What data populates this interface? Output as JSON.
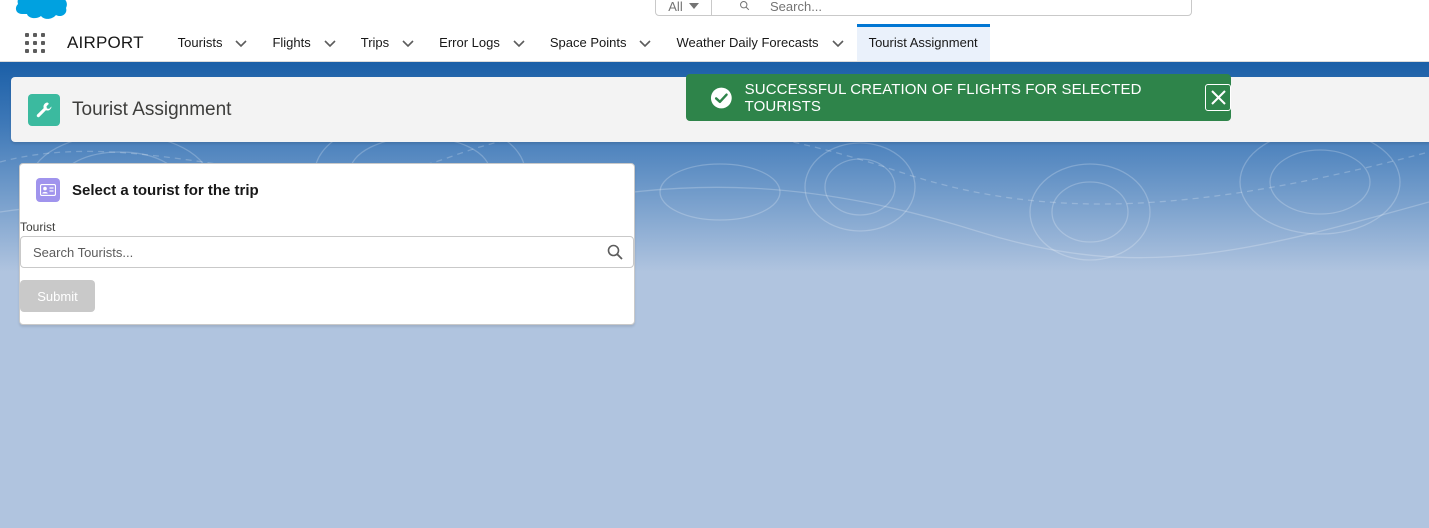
{
  "global_header": {
    "search": {
      "scope_label": "All",
      "placeholder": "Search..."
    }
  },
  "navbar": {
    "app_name": "AIRPORT",
    "items": [
      {
        "label": "Tourists",
        "has_menu": true
      },
      {
        "label": "Flights",
        "has_menu": true
      },
      {
        "label": "Trips",
        "has_menu": true
      },
      {
        "label": "Error Logs",
        "has_menu": true
      },
      {
        "label": "Space Points",
        "has_menu": true
      },
      {
        "label": "Weather Daily Forecasts",
        "has_menu": true
      },
      {
        "label": "Tourist Assignment",
        "has_menu": false,
        "active": true
      }
    ]
  },
  "page_header": {
    "title": "Tourist Assignment",
    "icon": "wrench-icon",
    "icon_color": "#3bba9f"
  },
  "toast": {
    "message": "SUCCESSFUL CREATION OF FLIGHTS FOR SELECTED TOURISTS",
    "variant": "success",
    "color": "#2e844a"
  },
  "card": {
    "title": "Select a tourist for the trip",
    "icon": "contact-card-icon",
    "icon_color": "#a094ed",
    "field_label": "Tourist",
    "lookup_placeholder": "Search Tourists...",
    "submit_label": "Submit",
    "submit_disabled": true
  },
  "colors": {
    "brand": "#0176d3",
    "background": "#b0c4df"
  }
}
